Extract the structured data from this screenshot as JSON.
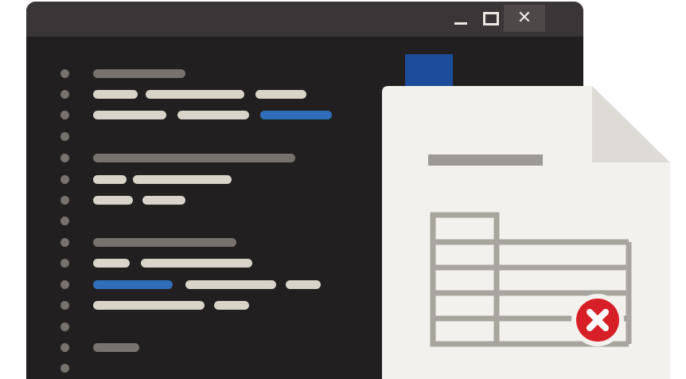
{
  "window": {
    "controls": {
      "minimize_icon": "minimize-icon",
      "maximize_icon": "maximize-icon",
      "close_icon": "close-icon",
      "close_glyph": "✕"
    }
  },
  "document": {
    "icon": "spreadsheet-document-icon",
    "status_icon": "error-icon"
  },
  "colors": {
    "editor_background": "#221f20",
    "titlebar": "#3a3536",
    "code_dim": "#77726e",
    "code_light": "#d9d4ca",
    "code_accent": "#2f6fba",
    "doc_paper": "#f3f1ee",
    "tag_blue": "#1c4b9a",
    "tag_green": "#2fa45c",
    "error_red": "#d61f26"
  }
}
